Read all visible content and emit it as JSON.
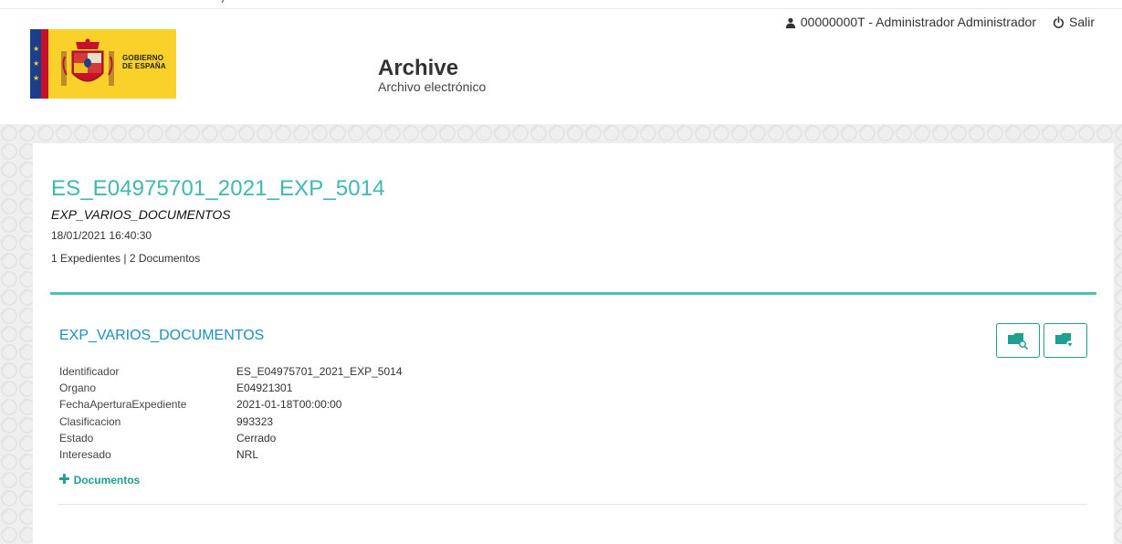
{
  "top_strip": {
    "cut_text": "/"
  },
  "user_bar": {
    "user_label": "00000000T - Administrador Administrador",
    "logout_label": "Salir"
  },
  "header": {
    "logo_text_line1": "GOBIERNO",
    "logo_text_line2": "DE ESPAÑA",
    "app_title": "Archive",
    "app_subtitle": "Archivo electrónico"
  },
  "expediente": {
    "code": "ES_E04975701_2021_EXP_5014",
    "type": "EXP_VARIOS_DOCUMENTOS",
    "datetime": "18/01/2021 16:40:30",
    "counts": "1 Expedientes | 2 Documentos"
  },
  "section": {
    "title": "EXP_VARIOS_DOCUMENTOS",
    "metadata": [
      {
        "key": "Identificador",
        "value": "ES_E04975701_2021_EXP_5014"
      },
      {
        "key": "Organo",
        "value": "E04921301"
      },
      {
        "key": "FechaAperturaExpediente",
        "value": "2021-01-18T00:00:00"
      },
      {
        "key": "Clasificacion",
        "value": "993323"
      },
      {
        "key": "Estado",
        "value": "Cerrado"
      },
      {
        "key": "Interesado",
        "value": "NRL"
      }
    ],
    "documents_link": "Documentos",
    "actions": [
      {
        "icon": "folder-search-icon"
      },
      {
        "icon": "folder-download-icon"
      }
    ]
  },
  "colors": {
    "accent_teal": "#3fb8ad",
    "divider_teal": "#4bc2b2",
    "section_title_blue": "#1a8fbf",
    "button_teal": "#1f9e91"
  }
}
